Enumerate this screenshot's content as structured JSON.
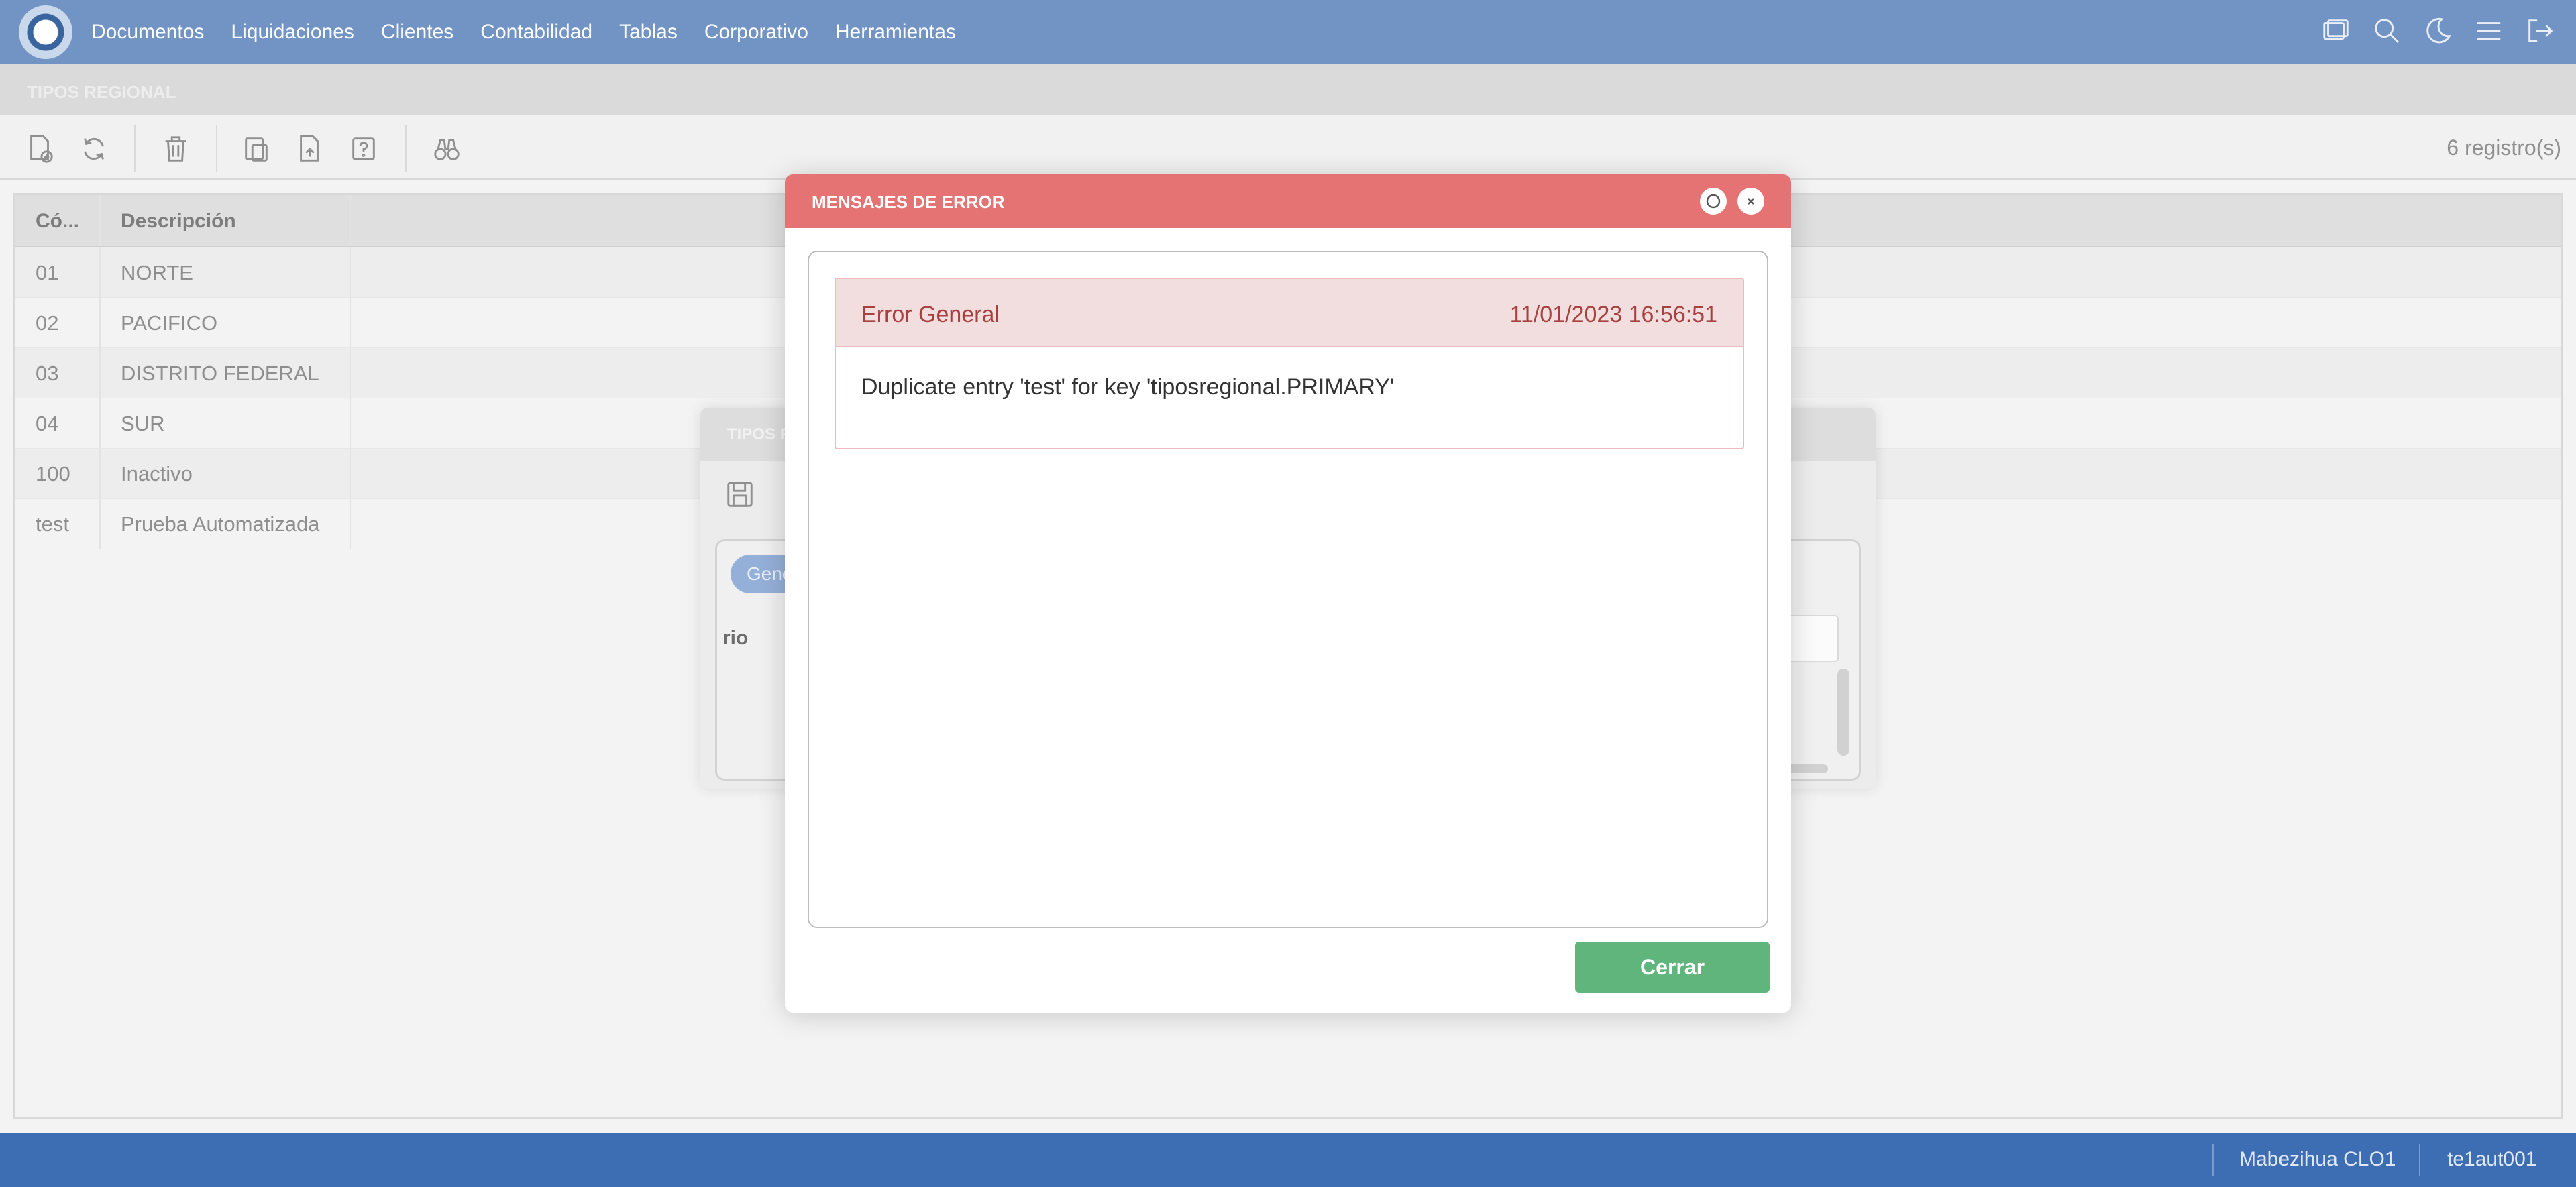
{
  "nav": {
    "menu": [
      "Documentos",
      "Liquidaciones",
      "Clientes",
      "Contabilidad",
      "Tablas",
      "Corporativo",
      "Herramientas"
    ],
    "icons": [
      "windows-icon",
      "search-icon",
      "moon-icon",
      "menu-icon",
      "logout-icon"
    ]
  },
  "section": {
    "title": "TIPOS REGIONAL"
  },
  "toolbar": {
    "icons": [
      "new-document-icon",
      "refresh-icon",
      "delete-icon",
      "copy-icon",
      "export-icon",
      "help-icon",
      "binoculars-icon"
    ],
    "record_count": "6 registro(s)"
  },
  "grid": {
    "headers": [
      "Có...",
      "Descripción"
    ],
    "rows": [
      [
        "01",
        "NORTE"
      ],
      [
        "02",
        "PACIFICO"
      ],
      [
        "03",
        "DISTRITO FEDERAL"
      ],
      [
        "04",
        "SUR"
      ],
      [
        "100",
        "Inactivo"
      ],
      [
        "test",
        "Prueba Automatizada"
      ]
    ]
  },
  "bg_dialog": {
    "title": "TIPOS R",
    "tab_label": "Gene",
    "field_label": "rio"
  },
  "modal": {
    "title": "MENSAJES DE ERROR",
    "error_title": "Error General",
    "error_time": "11/01/2023 16:56:51",
    "error_message": "Duplicate entry 'test' for key 'tiposregional.PRIMARY'",
    "close_label": "Cerrar"
  },
  "status": {
    "user1": "Mabezihua CLO1",
    "user2": "te1aut001"
  },
  "colors": {
    "nav": "#6b8fc2",
    "error_header": "#e57373",
    "close_button": "#5fb57c",
    "status_bar": "#3d6db2"
  }
}
